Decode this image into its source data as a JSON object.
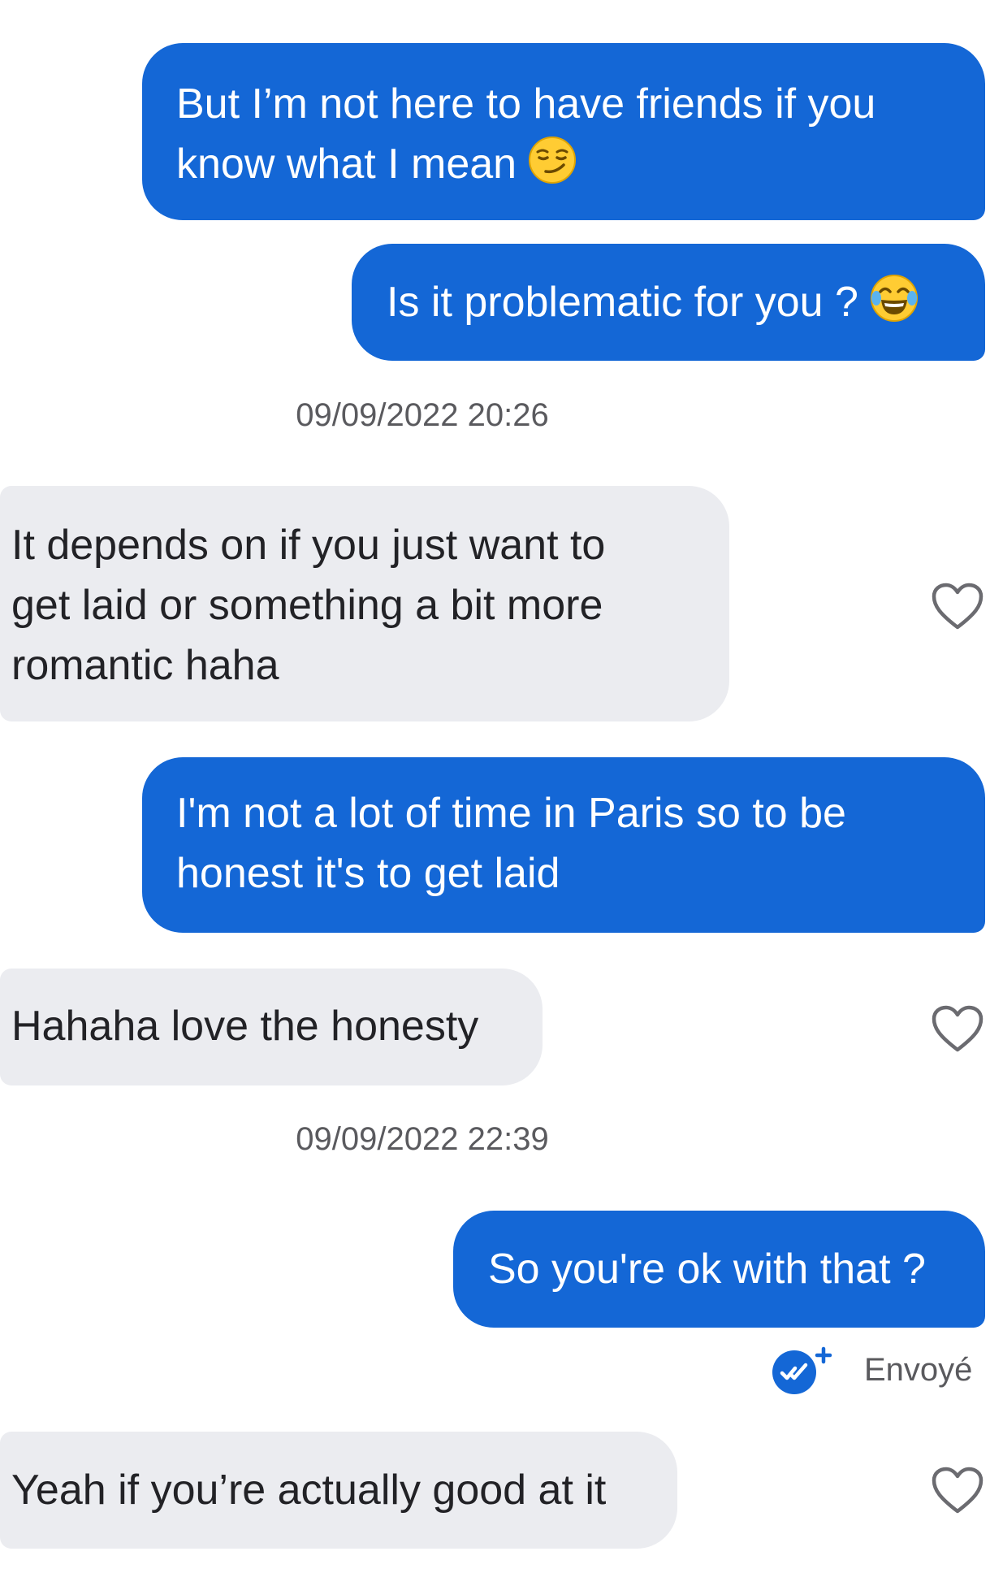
{
  "colors": {
    "outgoing_bubble": "#1467d6",
    "incoming_bubble": "#ebecf0",
    "timestamp_text": "#5a5a5e",
    "heart_outline": "#6b6b70"
  },
  "messages": [
    {
      "direction": "outgoing",
      "lines": [
        "But I’m not here to have friends if you",
        "know what I mean"
      ],
      "emoji": "smirking-face"
    },
    {
      "direction": "outgoing",
      "lines": [
        "Is it problematic for you ?"
      ],
      "emoji": "tears-of-joy-face"
    },
    {
      "direction": "incoming",
      "lines": [
        "It depends on if you just want to",
        "get laid or something a bit more",
        "romantic haha"
      ],
      "like_icon": "heart-outline-icon"
    },
    {
      "direction": "outgoing",
      "lines": [
        "I'm not a lot of time in Paris so to be",
        "honest it's to get laid"
      ]
    },
    {
      "direction": "incoming",
      "lines": [
        "Hahaha love the honesty"
      ],
      "like_icon": "heart-outline-icon"
    },
    {
      "direction": "outgoing",
      "lines": [
        "So you're ok with that ?"
      ]
    },
    {
      "direction": "incoming",
      "lines": [
        "Yeah if you’re actually good at it"
      ],
      "like_icon": "heart-outline-icon"
    }
  ],
  "timestamps": [
    "09/09/2022 20:26",
    "09/09/2022 22:39"
  ],
  "delivery_status": {
    "label": "Envoyé",
    "icon": "sent-check-plus-icon"
  }
}
